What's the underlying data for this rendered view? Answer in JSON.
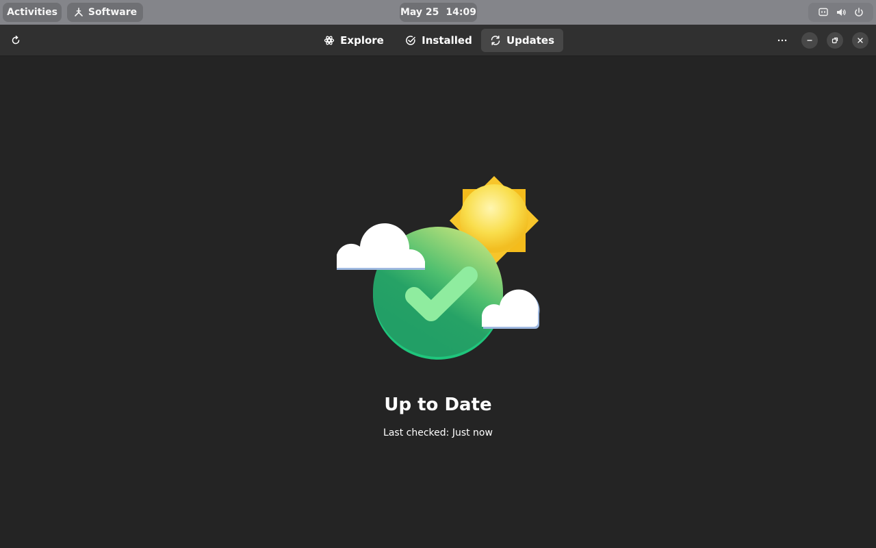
{
  "topbar": {
    "activities_label": "Activities",
    "app_label": "Software",
    "date": "May 25",
    "time": "14:09",
    "tray_icons": [
      "display-icon",
      "volume-icon",
      "power-icon"
    ]
  },
  "header": {
    "refresh_icon": "refresh-icon",
    "tabs": [
      {
        "label": "Explore",
        "icon": "explore-icon",
        "active": false
      },
      {
        "label": "Installed",
        "icon": "installed-check-icon",
        "active": false
      },
      {
        "label": "Updates",
        "icon": "updates-sync-icon",
        "active": true
      }
    ],
    "menu_icon": "more-icon",
    "window_controls": [
      "minimize-icon",
      "maximize-icon",
      "close-icon"
    ]
  },
  "main": {
    "illustration": "up-to-date-illustration",
    "title": "Up to Date",
    "subtitle": "Last checked: Just now"
  },
  "colors": {
    "background": "#242424",
    "topbar": "#84858a",
    "headerbar": "#303030",
    "active_tab": "#474747",
    "check_green": "#2ea66a",
    "sun_yellow": "#f7c52b"
  }
}
